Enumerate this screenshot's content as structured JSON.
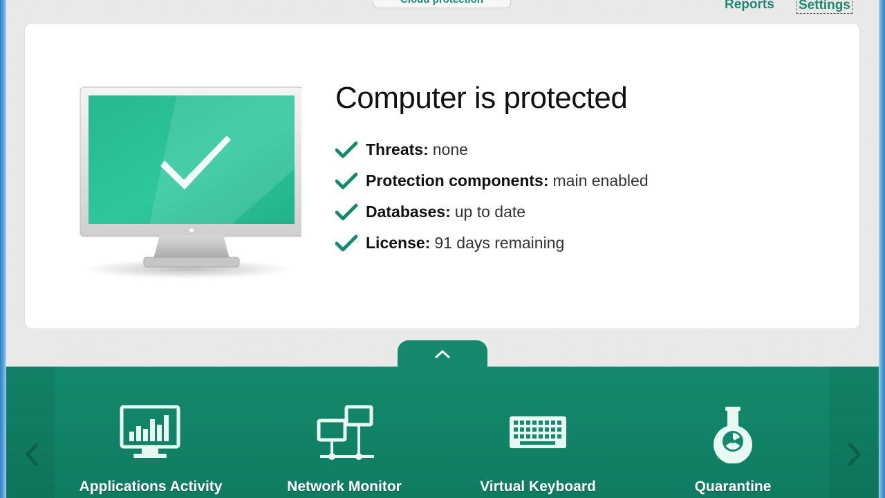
{
  "toolbar": {
    "cloud_protection_label": "Cloud protection",
    "reports_label": "Reports",
    "settings_label": "Settings"
  },
  "status": {
    "title": "Computer is protected",
    "items": [
      {
        "key": "Threats:",
        "value": "none"
      },
      {
        "key": "Protection components:",
        "value": "main enabled"
      },
      {
        "key": "Databases:",
        "value": "up to date"
      },
      {
        "key": "License:",
        "value": "91 days remaining"
      }
    ]
  },
  "tools": [
    {
      "label": "Applications Activity",
      "icon": "bar-chart-monitor-icon"
    },
    {
      "label": "Network Monitor",
      "icon": "network-icon"
    },
    {
      "label": "Virtual Keyboard",
      "icon": "keyboard-icon"
    },
    {
      "label": "Quarantine",
      "icon": "flask-radiation-icon"
    }
  ],
  "colors": {
    "accent": "#14896d",
    "link": "#1c8a72",
    "screen_green": "#2ec79e"
  }
}
